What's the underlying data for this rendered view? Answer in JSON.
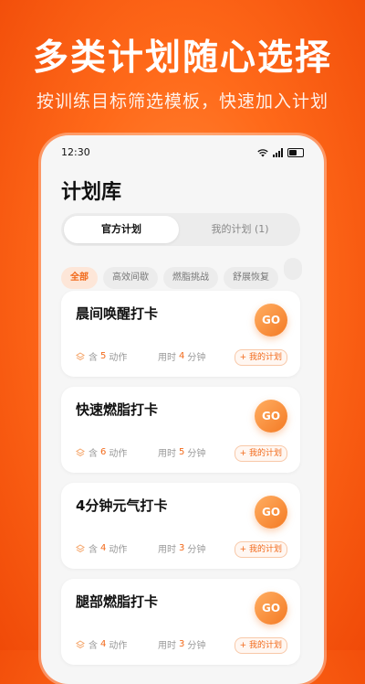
{
  "promo": {
    "title": "多类计划随心选择",
    "subtitle": "按训练目标筛选模板，快速加入计划"
  },
  "status_bar": {
    "time": "12:30"
  },
  "page": {
    "title": "计划库"
  },
  "tabs": [
    {
      "label": "官方计划",
      "active": true
    },
    {
      "label": "我的计划 (1)",
      "active": false
    }
  ],
  "filters": [
    {
      "label": "全部",
      "active": true
    },
    {
      "label": "高效间歇",
      "active": false
    },
    {
      "label": "燃脂挑战",
      "active": false
    },
    {
      "label": "舒展恢复",
      "active": false
    }
  ],
  "cards": [
    {
      "title": "晨间唤醒打卡",
      "go": "GO",
      "actions_prefix": "含",
      "actions_count": "5",
      "actions_suffix": "动作",
      "time_prefix": "用时",
      "time_value": "4",
      "time_suffix": "分钟",
      "add_label": "+ 我的计划"
    },
    {
      "title": "快速燃脂打卡",
      "go": "GO",
      "actions_prefix": "含",
      "actions_count": "6",
      "actions_suffix": "动作",
      "time_prefix": "用时",
      "time_value": "5",
      "time_suffix": "分钟",
      "add_label": "+ 我的计划"
    },
    {
      "title": "4分钟元气打卡",
      "go": "GO",
      "actions_prefix": "含",
      "actions_count": "4",
      "actions_suffix": "动作",
      "time_prefix": "用时",
      "time_value": "3",
      "time_suffix": "分钟",
      "add_label": "+ 我的计划"
    },
    {
      "title": "腿部燃脂打卡",
      "go": "GO",
      "actions_prefix": "含",
      "actions_count": "4",
      "actions_suffix": "动作",
      "time_prefix": "用时",
      "time_value": "3",
      "time_suffix": "分钟",
      "add_label": "+ 我的计划"
    }
  ],
  "colors": {
    "accent": "#f26a1b",
    "background": "#ff6a1a"
  },
  "icons": [
    "wifi-icon",
    "signal-icon",
    "battery-icon",
    "layers-icon"
  ]
}
